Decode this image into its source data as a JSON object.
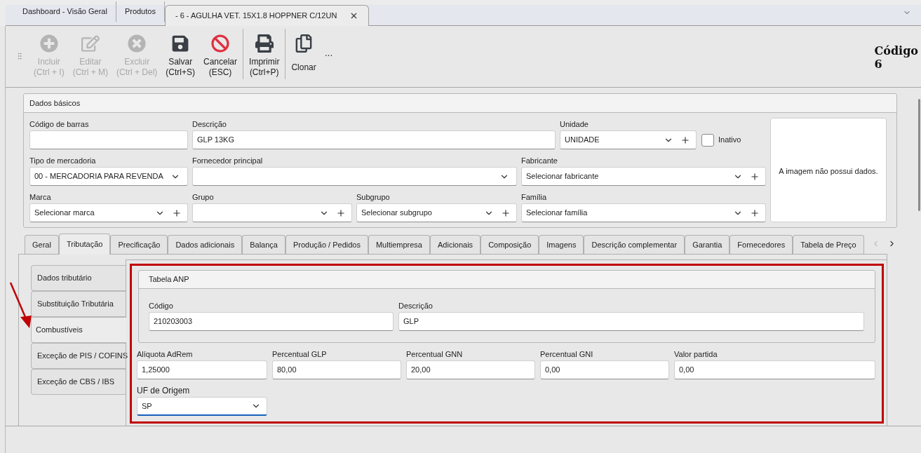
{
  "doc_tabs": [
    {
      "label": "Dashboard - Visão Geral",
      "selected": false,
      "closable": false
    },
    {
      "label": "Produtos",
      "selected": false,
      "closable": false
    },
    {
      "label": "- 6 - AGULHA VET. 15X1.8 HOPPNER C/12UN",
      "selected": true,
      "closable": true
    }
  ],
  "toolbar": [
    {
      "kind": "plus",
      "label": "Incluir",
      "shortcut": "(Ctrl + I)",
      "disabled": true,
      "separator_before": false
    },
    {
      "kind": "edit",
      "label": "Editar",
      "shortcut": "(Ctrl + M)",
      "disabled": true,
      "separator_before": false
    },
    {
      "kind": "delete",
      "label": "Excluir",
      "shortcut": "(Ctrl + Del)",
      "disabled": true,
      "separator_before": false
    },
    {
      "kind": "save",
      "label": "Salvar",
      "shortcut": "(Ctrl+S)",
      "disabled": false,
      "separator_before": false
    },
    {
      "kind": "cancel",
      "label": "Cancelar",
      "shortcut": "(ESC)",
      "disabled": false,
      "separator_before": false
    },
    {
      "kind": "print",
      "label": "Imprimir",
      "shortcut": "(Ctrl+P)",
      "disabled": false,
      "separator_before": true
    },
    {
      "kind": "copy",
      "label": "Clonar",
      "disabled": false,
      "separator_before": true
    }
  ],
  "toolbar_more": "...",
  "record": {
    "label": "Código",
    "value": "6"
  },
  "basic_data": {
    "title": "Dados básicos",
    "fields": [
      {
        "kind": "text",
        "label": "Código de barras"
      },
      {
        "kind": "text",
        "label": "Descrição",
        "value": "GLP 13KG"
      },
      {
        "kind": "select_add",
        "label": "Unidade",
        "value": "UNIDADE"
      },
      {
        "kind": "checkbox",
        "label": "Inativo",
        "checked": false
      },
      {
        "kind": "select",
        "label": "Tipo de mercadoria",
        "value": "00 - MERCADORIA PARA REVENDA"
      },
      {
        "kind": "select",
        "label": "Fornecedor principal"
      },
      {
        "kind": "select_add",
        "label": "Fabricante",
        "placeholder": "Selecionar fabricante"
      },
      {
        "kind": "select_add",
        "label": "Marca",
        "placeholder": "Selecionar marca"
      },
      {
        "kind": "select_add",
        "label": "Grupo"
      },
      {
        "kind": "select_add",
        "label": "Subgrupo",
        "placeholder": "Selecionar subgrupo"
      },
      {
        "kind": "select_add",
        "label": "Família",
        "placeholder": "Selecionar família"
      }
    ],
    "image_text": "A imagem não possui dados."
  },
  "detail_tabs": [
    {
      "label": "Geral",
      "selected": false
    },
    {
      "label": "Tributação",
      "selected": true
    },
    {
      "label": "Precificação",
      "selected": false
    },
    {
      "label": "Dados adicionais",
      "selected": false
    },
    {
      "label": "Balança",
      "selected": false
    },
    {
      "label": "Produção / Pedidos",
      "selected": false
    },
    {
      "label": "Multiempresa",
      "selected": false
    },
    {
      "label": "Adicionais",
      "selected": false
    },
    {
      "label": "Composição",
      "selected": false
    },
    {
      "label": "Imagens",
      "selected": false
    },
    {
      "label": "Descrição complementar",
      "selected": false
    },
    {
      "label": "Garantia",
      "selected": false
    },
    {
      "label": "Fornecedores",
      "selected": false
    },
    {
      "label": "Tabela de Preço",
      "selected": false
    }
  ],
  "side_tabs": [
    {
      "label": "Dados tributário",
      "selected": false
    },
    {
      "label": "Substituição Tributária",
      "selected": false
    },
    {
      "label": "Combustíveis",
      "selected": true
    },
    {
      "label": "Exceção de PIS / COFINS",
      "selected": false
    },
    {
      "label": "Exceção de CBS / IBS",
      "selected": false
    }
  ],
  "anp": {
    "title": "Tabela ANP",
    "fields": [
      {
        "label": "Código",
        "value": "210203003"
      },
      {
        "label": "Descrição",
        "value": "GLP"
      }
    ]
  },
  "fuel_fields": [
    {
      "label": "Alíquota AdRem",
      "value": "1,25000"
    },
    {
      "label": "Percentual GLP",
      "value": "80,00"
    },
    {
      "label": "Percentual GNN",
      "value": "20,00"
    },
    {
      "label": "Percentual GNI",
      "value": "0,00"
    },
    {
      "label": "Valor partida",
      "value": "0,00"
    }
  ],
  "origin": {
    "label": "UF de Origem",
    "value": "SP",
    "focused": true
  }
}
